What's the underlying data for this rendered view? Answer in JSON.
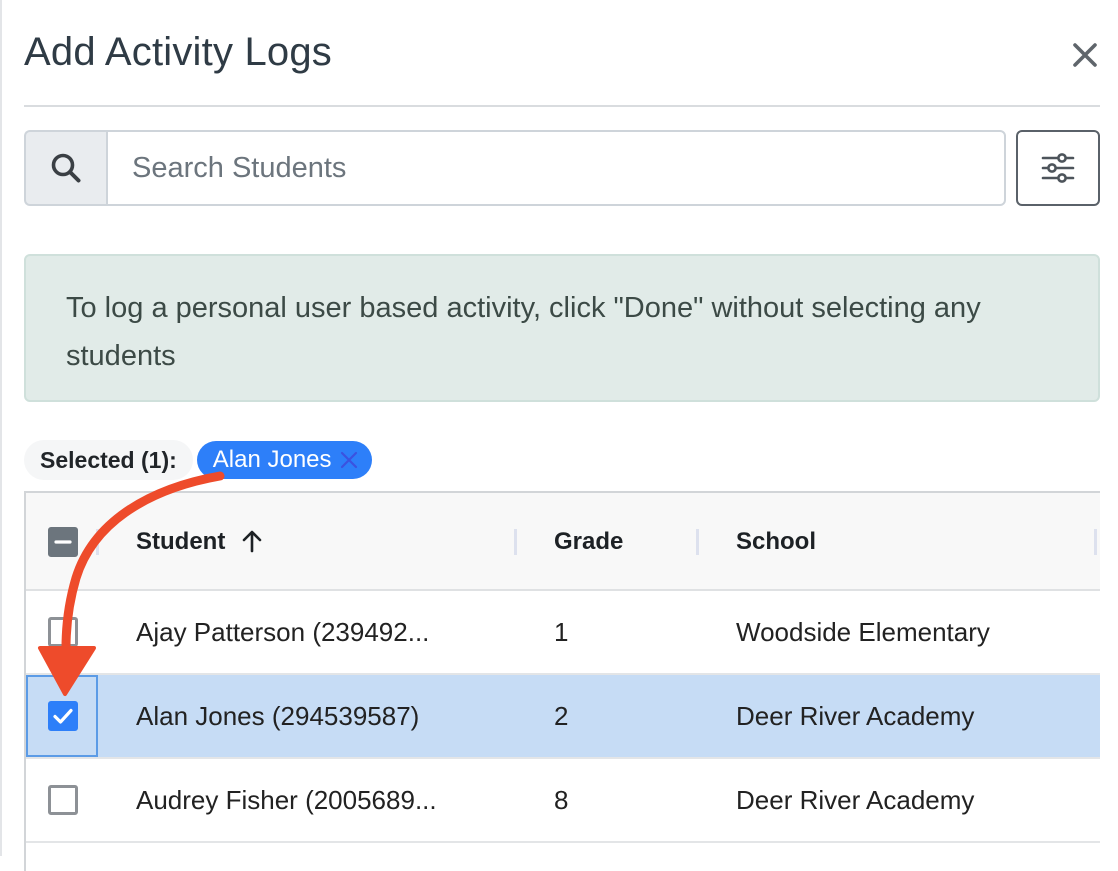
{
  "modal": {
    "title": "Add Activity Logs",
    "close_label": "×"
  },
  "search": {
    "placeholder": "Search Students",
    "value": ""
  },
  "alert": {
    "text": "To log a personal user based activity, click \"Done\" without selecting any students"
  },
  "selection": {
    "label": "Selected (1):",
    "chips": [
      {
        "name": "Alan Jones"
      }
    ]
  },
  "table": {
    "columns": [
      "Student",
      "Grade",
      "School"
    ],
    "sort": {
      "column": "Student",
      "direction": "asc"
    },
    "rows": [
      {
        "student": "Ajay Patterson (239492...",
        "grade": "1",
        "school": "Woodside Elementary",
        "checked": false
      },
      {
        "student": "Alan Jones (294539587)",
        "grade": "2",
        "school": "Deer River Academy",
        "checked": true
      },
      {
        "student": "Audrey Fisher (2005689...",
        "grade": "8",
        "school": "Deer River Academy",
        "checked": false
      }
    ]
  },
  "colors": {
    "accent": "#2d7ff9",
    "selected_row": "#c6dcf5",
    "alert_bg": "#e1ebe8",
    "annotation_arrow": "#ee4b2b"
  }
}
